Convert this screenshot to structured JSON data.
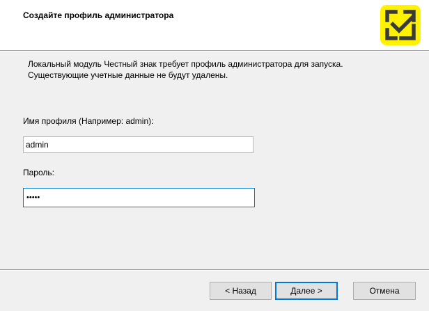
{
  "header": {
    "title": "Создайте профиль администратора",
    "logo_icon": "chestny-znak-logo-icon",
    "logo_color": "#fff200"
  },
  "description": "Локальный модуль Честный знак требует профиль администратора для запуска. Существующие учетные данные не будут удалены.",
  "form": {
    "login_label": "Имя профиля (Например: admin):",
    "login_value": "admin",
    "password_label": "Пароль:",
    "password_value": "•••••"
  },
  "buttons": {
    "back": "< Назад",
    "next": "Далее >",
    "cancel": "Отмена"
  },
  "colors": {
    "accent": "#0078d7",
    "background": "#f0f0f0"
  }
}
